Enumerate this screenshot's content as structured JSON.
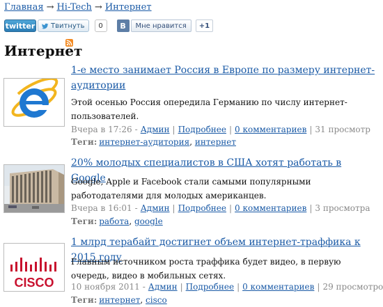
{
  "breadcrumb": {
    "items": [
      "Главная",
      "Hi-Tech",
      "Интернет"
    ],
    "separator": "→"
  },
  "social": {
    "twitter_label": "twitter",
    "tweet_label": "Твитнуть",
    "tweet_count": "0",
    "vk_logo": "В",
    "vk_like_label": "Мне нравится",
    "vk_count": "+1"
  },
  "page": {
    "title": "Интернет",
    "rss_icon": "rss-icon"
  },
  "posts": [
    {
      "title": "1-е место занимает Россия в Европе по размеру интернет-аудитории",
      "text": "Этой осенью Россия опередила Германию по числу интернет-пользователей.",
      "date": "Вчера в 17:26",
      "author": "Админ",
      "more": "Подробнее",
      "comments": "0 комментариев",
      "views": "31 просмотр",
      "tags_label": "Теги:",
      "tags": [
        "интернет-аудитория",
        "интернет"
      ],
      "image": "internet-explorer-logo"
    },
    {
      "title": "20% молодых специалистов в США хотят работать в Google",
      "text": "Google, Apple и Facebook стали самыми популярными работодателями для молодых американцев.",
      "date": "Вчера в 16:01",
      "author": "Админ",
      "more": "Подробнее",
      "comments": "0 комментариев",
      "views": "3 просмотра",
      "tags_label": "Теги:",
      "tags": [
        "работа",
        "google"
      ],
      "image": "office-building-photo"
    },
    {
      "title": "1 млрд терабайт достигнет объем интернет-траффика к 2015 году",
      "text": "Главным источником роста траффика будет видео, в первую очередь, видео в мобильных сетях.",
      "date": "10 ноября 2011",
      "author": "Админ",
      "more": "Подробнее",
      "comments": "0 комментариев",
      "views": "29 просмотров",
      "tags_label": "Теги:",
      "tags": [
        "интернет",
        "cisco"
      ],
      "image": "cisco-logo",
      "image_text": "CISCO"
    }
  ],
  "colors": {
    "link": "#1a5aa6",
    "meta": "#8a8a8a",
    "cisco_red": "#c8102e",
    "ie_blue": "#1f78d1",
    "rss_orange": "#f38a22"
  }
}
